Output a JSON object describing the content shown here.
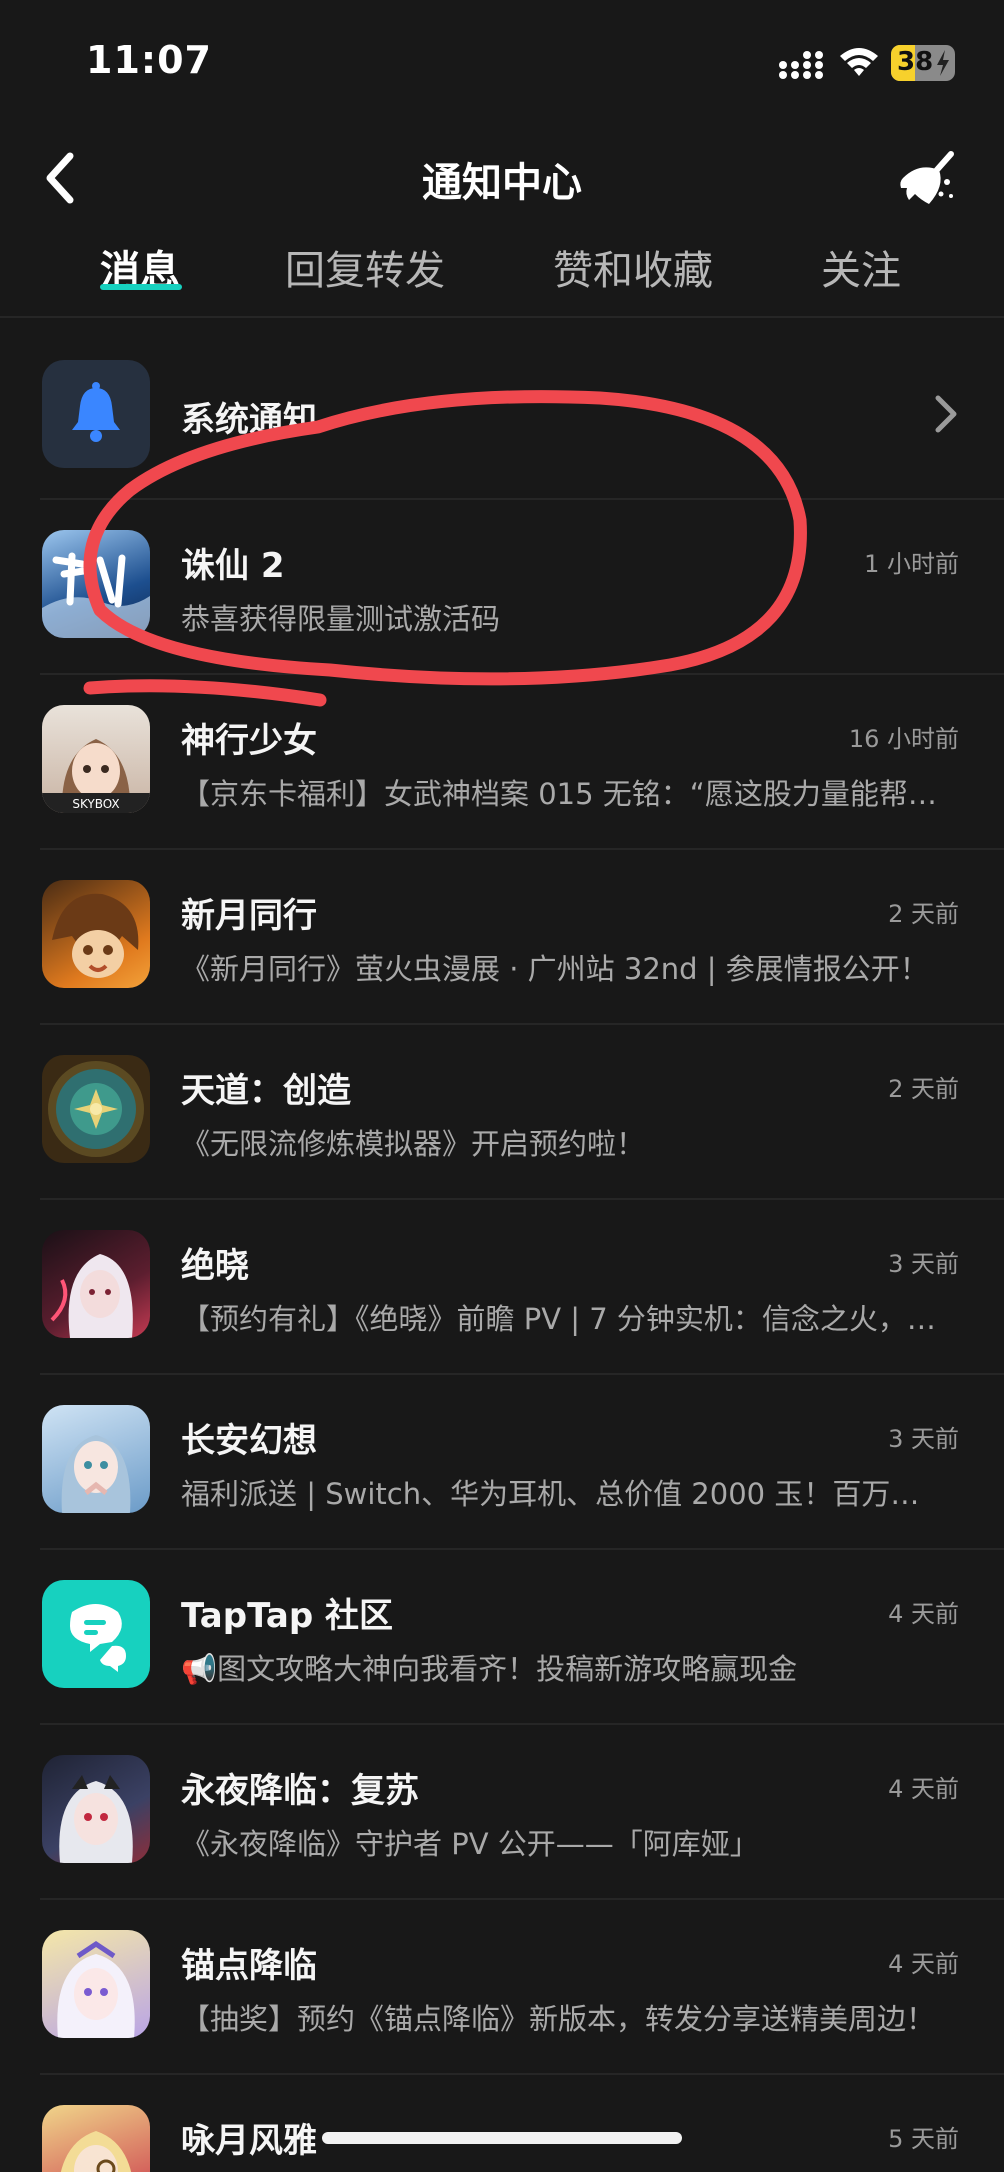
{
  "status_bar": {
    "time": "11:07",
    "battery": "38",
    "battery_level": 0.38
  },
  "header": {
    "title": "通知中心"
  },
  "tabs": [
    {
      "label": "消息",
      "active": true
    },
    {
      "label": "回复转发",
      "active": false
    },
    {
      "label": "赞和收藏",
      "active": false
    },
    {
      "label": "关注",
      "active": false
    }
  ],
  "system_notice": {
    "label": "系统通知"
  },
  "messages": [
    {
      "name": "诛仙 2",
      "time": "1 小时前",
      "text": "恭喜获得限量测试激活码"
    },
    {
      "name": "神行少女",
      "time": "16 小时前",
      "text": "【京东卡福利】女武神档案 015 无铭：“愿这股力量能帮…"
    },
    {
      "name": "新月同行",
      "time": "2 天前",
      "text": "《新月同行》萤火虫漫展 · 广州站 32nd | 参展情报公开！"
    },
    {
      "name": "天道：创造",
      "time": "2 天前",
      "text": "《无限流修炼模拟器》开启预约啦！"
    },
    {
      "name": "绝晓",
      "time": "3 天前",
      "text": "【预约有礼】《绝晓》前瞻 PV | 7 分钟实机：信念之火，…"
    },
    {
      "name": "长安幻想",
      "time": "3 天前",
      "text": "福利派送 | Switch、华为耳机、总价值 2000 玉！百万…"
    },
    {
      "name": "TapTap 社区",
      "time": "4 天前",
      "text": "📢图文攻略大神向我看齐！投稿新游攻略赢现金"
    },
    {
      "name": "永夜降临：复苏",
      "time": "4 天前",
      "text": "《永夜降临》守护者 PV 公开——「阿库娅」"
    },
    {
      "name": "锚点降临",
      "time": "4 天前",
      "text": "【抽奖】预约《锚点降临》新版本，转发分享送精美周边！"
    },
    {
      "name": "咏月风雅",
      "time": "5 天前",
      "text": ""
    }
  ],
  "colors": {
    "accent": "#17d1bf",
    "background": "#181818",
    "annotation": "#f0484e"
  }
}
